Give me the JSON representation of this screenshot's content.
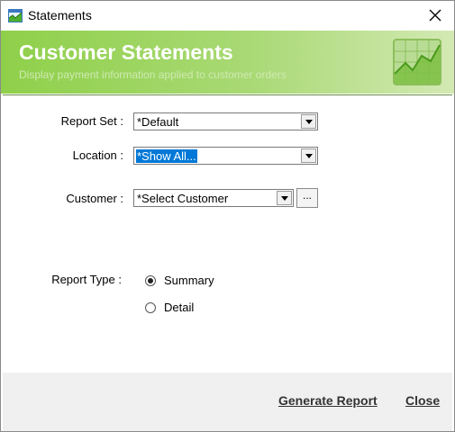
{
  "window": {
    "title": "Statements",
    "icon": "statements-chart-icon"
  },
  "banner": {
    "title": "Customer Statements",
    "subtitle": "Display payment information applied to customer orders",
    "icon": "growth-chart-icon"
  },
  "form": {
    "report_set": {
      "label": "Report Set :",
      "value": "*Default"
    },
    "location": {
      "label": "Location :",
      "value": "*Show All..."
    },
    "customer": {
      "label": "Customer :",
      "value": "*Select Customer",
      "browse_label": "..."
    },
    "report_type": {
      "label": "Report Type :",
      "options": [
        {
          "label": "Summary",
          "selected": true
        },
        {
          "label": "Detail",
          "selected": false
        }
      ]
    }
  },
  "footer": {
    "generate_label": "Generate Report",
    "close_label": "Close"
  },
  "colors": {
    "banner_start": "#8fd04a",
    "banner_end": "#d3e9b3",
    "selection": "#0078d7"
  }
}
